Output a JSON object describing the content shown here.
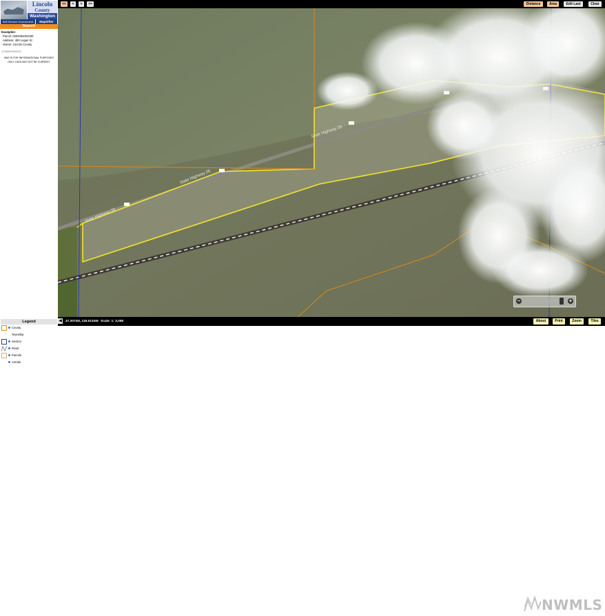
{
  "sidebar": {
    "logo": {
      "county_line1": "Lincoln",
      "county_line2": "County",
      "state": "Washington"
    },
    "tabs": {
      "self_service": "Self Service Government",
      "mapsifter": "MapSifter"
    },
    "search_label": "Search",
    "examples": {
      "heading": "Examples:",
      "parcel": "Parcel: 0302094001000",
      "address": "Address: 450 Logan St",
      "owner": "Owner: Lincoln County"
    },
    "search_value": "2236050900001",
    "disclaimer_line1": "MAP IS FOR INFORMATIONAL PURPOSES",
    "disclaimer_line2": "ONLY. DATA MAY NOT BE CURRENT."
  },
  "toolbar": {
    "nav_first": "<<",
    "nav_prev": "<",
    "nav_next": ">",
    "nav_last": ">>",
    "distance": "Distance",
    "area": "Area",
    "edit_last": "Edit Last",
    "clear": "Clear"
  },
  "map": {
    "road_label": "State Highway 28",
    "road_shield": "28"
  },
  "zoom": {
    "out": "−",
    "in": "+",
    "level": 0.9
  },
  "statusbar": {
    "collapse": "◀",
    "coordinates": "47.3074N, 118.5134W",
    "scale": "Scale: 1: 3,058",
    "about": "About",
    "print": "Print",
    "zoom": "Zoom",
    "tiles": "Tiles"
  },
  "legend": {
    "title": "Legend",
    "items": [
      {
        "label": "County",
        "color": "#e58a00"
      },
      {
        "label": "Township",
        "color": "#999999"
      },
      {
        "label": "Section",
        "color": "#1f3aa0"
      },
      {
        "label": "Road",
        "color": "#666666"
      },
      {
        "label": "Parcels",
        "color": "#e0b060"
      },
      {
        "label": "Aerials",
        "color": "#3a6fd0"
      }
    ]
  },
  "watermark": "NWMLS",
  "colors": {
    "parcel_outline": "#f2e62a",
    "county_line": "#d98a1a",
    "section_line": "#2a3aa8",
    "search_orange": "#f28c1e",
    "mapsifter_blue": "#1d3f80"
  }
}
